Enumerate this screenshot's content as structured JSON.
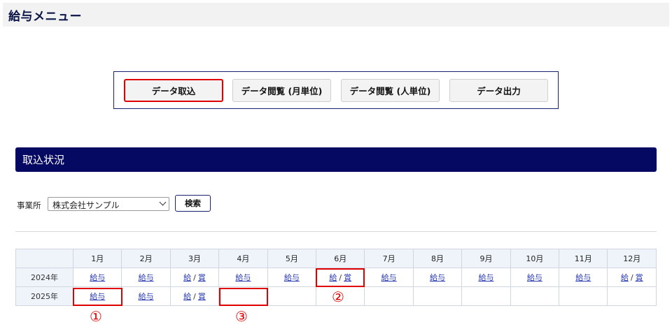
{
  "header": {
    "title": "給与メニュー"
  },
  "menu": {
    "buttons": [
      {
        "label": "データ取込"
      },
      {
        "label": "データ閲覧 (月単位)"
      },
      {
        "label": "データ閲覧 (人単位)"
      },
      {
        "label": "データ出力"
      }
    ]
  },
  "section": {
    "title": "取込状況"
  },
  "filter": {
    "office_label": "事業所",
    "office_value": "株式会社サンプル",
    "search_label": "検索"
  },
  "table": {
    "months": [
      "1月",
      "2月",
      "3月",
      "4月",
      "5月",
      "6月",
      "7月",
      "8月",
      "9月",
      "10月",
      "11月",
      "12月"
    ],
    "rows": [
      {
        "year": "2024年",
        "cells": [
          [
            "給与"
          ],
          [
            "給与"
          ],
          [
            "給",
            "賞"
          ],
          [
            "給与"
          ],
          [
            "給与"
          ],
          [
            "給",
            "賞"
          ],
          [
            "給与"
          ],
          [
            "給与"
          ],
          [
            "給与"
          ],
          [
            "給与"
          ],
          [
            "給与"
          ],
          [
            "給",
            "賞"
          ]
        ]
      },
      {
        "year": "2025年",
        "cells": [
          [
            "給与"
          ],
          [
            "給与"
          ],
          [
            "給",
            "賞"
          ],
          [],
          [],
          [],
          [],
          [],
          [],
          [],
          [],
          []
        ]
      }
    ],
    "separator": "/"
  },
  "markers": [
    "①",
    "②",
    "③"
  ],
  "colors": {
    "navy": "#060962",
    "highlight": "#e00000",
    "link": "#2a3bb0"
  }
}
